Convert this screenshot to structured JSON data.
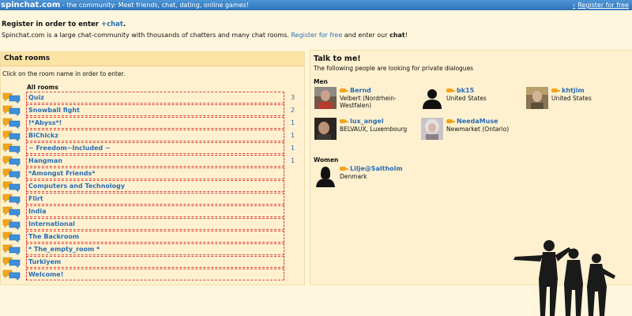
{
  "topbar": {
    "logo": "spinchat.com",
    "tagline": " - the community: Meet friends, chat, dating, online games!",
    "register_link": "Register for free"
  },
  "intro": {
    "heading_pre": "Register in order to enter ",
    "heading_plus": "+chat",
    "heading_post": ".",
    "text1": "Spinchat.com is a large chat-community with thousands of chatters and many chat rooms. ",
    "register_link": "Register for free",
    "text2": " and enter our ",
    "text_bold": "chat",
    "text3": "!"
  },
  "chat_rooms": {
    "title": "Chat rooms",
    "hint": "Click on the room name in order to enter.",
    "all_rooms_label": "All rooms",
    "rooms": [
      {
        "name": "Quiz",
        "count": "3"
      },
      {
        "name": "Snowball fight",
        "count": "2"
      },
      {
        "name": "!*Abyss*!",
        "count": "1"
      },
      {
        "name": "BiChickz",
        "count": "1"
      },
      {
        "name": "~ Freedom~Included ~",
        "count": "1"
      },
      {
        "name": "Hangman",
        "count": "1"
      },
      {
        "name": "*Amongst Friends*",
        "count": ""
      },
      {
        "name": "Computers and Technology",
        "count": ""
      },
      {
        "name": "Flirt",
        "count": ""
      },
      {
        "name": "India",
        "count": ""
      },
      {
        "name": "International",
        "count": ""
      },
      {
        "name": "The Backroom",
        "count": ""
      },
      {
        "name": "* The_empty_room *",
        "count": ""
      },
      {
        "name": "Turkiyem",
        "count": ""
      },
      {
        "name": "Welcome!",
        "count": ""
      }
    ]
  },
  "talk": {
    "title": "Talk to me!",
    "subtitle": "The following people are looking for private dialogues",
    "men_label": "Men",
    "women_label": "Women",
    "men": [
      {
        "name": "Bernd",
        "location": "Velbert (Nordrhein-Westfalen)"
      },
      {
        "name": "bk15",
        "location": "United States"
      },
      {
        "name": "khtjim",
        "location": "United States"
      },
      {
        "name": "lux_angel",
        "location": "BELVAUX, Luxembourg"
      },
      {
        "name": "NeedaMuse",
        "location": "Newmarket (Ontario)"
      }
    ],
    "women": [
      {
        "name": "Lilje@Saltholm",
        "location": "Denmark"
      }
    ]
  }
}
